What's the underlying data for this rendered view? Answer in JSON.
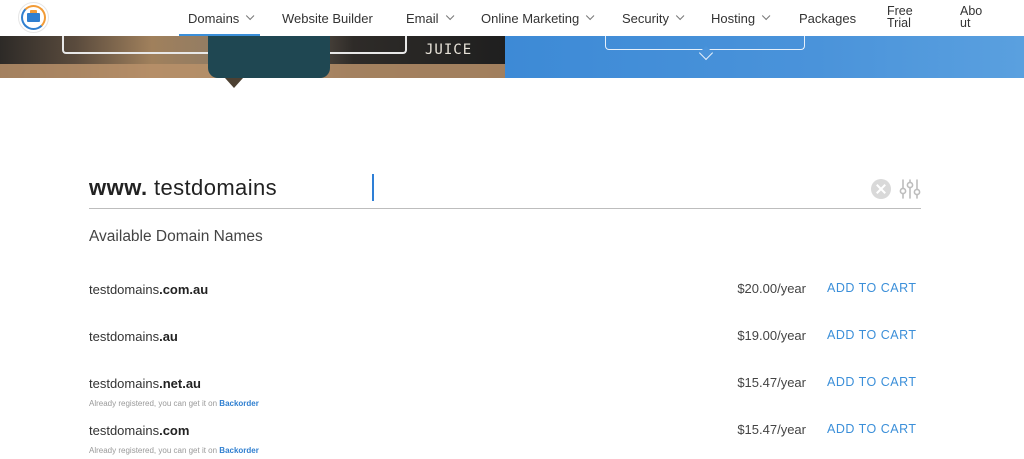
{
  "nav": {
    "items": [
      {
        "label": "Domains",
        "has_dropdown": true,
        "active": true
      },
      {
        "label": "Website Builder",
        "has_dropdown": false
      },
      {
        "label": "Email",
        "has_dropdown": true
      },
      {
        "label": "Online Marketing",
        "has_dropdown": true
      },
      {
        "label": "Security",
        "has_dropdown": true
      },
      {
        "label": "Hosting",
        "has_dropdown": true
      },
      {
        "label": "Packages",
        "has_dropdown": false
      },
      {
        "label": "Free\nTrial",
        "has_dropdown": false
      },
      {
        "label": "Abo\nut",
        "has_dropdown": false
      }
    ]
  },
  "hero": {
    "sign_text": "JUICE"
  },
  "search": {
    "prefix": "www.",
    "value": "testdomains",
    "clear_icon": "clear-circle-icon",
    "filter_icon": "sliders-icon"
  },
  "results": {
    "title": "Available Domain Names",
    "add_label": "ADD TO CART",
    "rows": [
      {
        "name": "testdomains",
        "tld": ".com.au",
        "price": "$20.00/year",
        "note": null
      },
      {
        "name": "testdomains",
        "tld": ".au",
        "price": "$19.00/year",
        "note": null
      },
      {
        "name": "testdomains",
        "tld": ".net.au",
        "price": "$15.47/year",
        "note": {
          "text": "Already registered, you can get it on ",
          "link": "Backorder"
        }
      },
      {
        "name": "testdomains",
        "tld": ".com",
        "price": "$15.47/year",
        "note": {
          "text": "Already registered, you can get it on ",
          "link": "Backorder"
        }
      }
    ]
  },
  "colors": {
    "accent": "#3b8fd9",
    "link": "#2f7fd0",
    "hero_blue": "#4a93da"
  }
}
